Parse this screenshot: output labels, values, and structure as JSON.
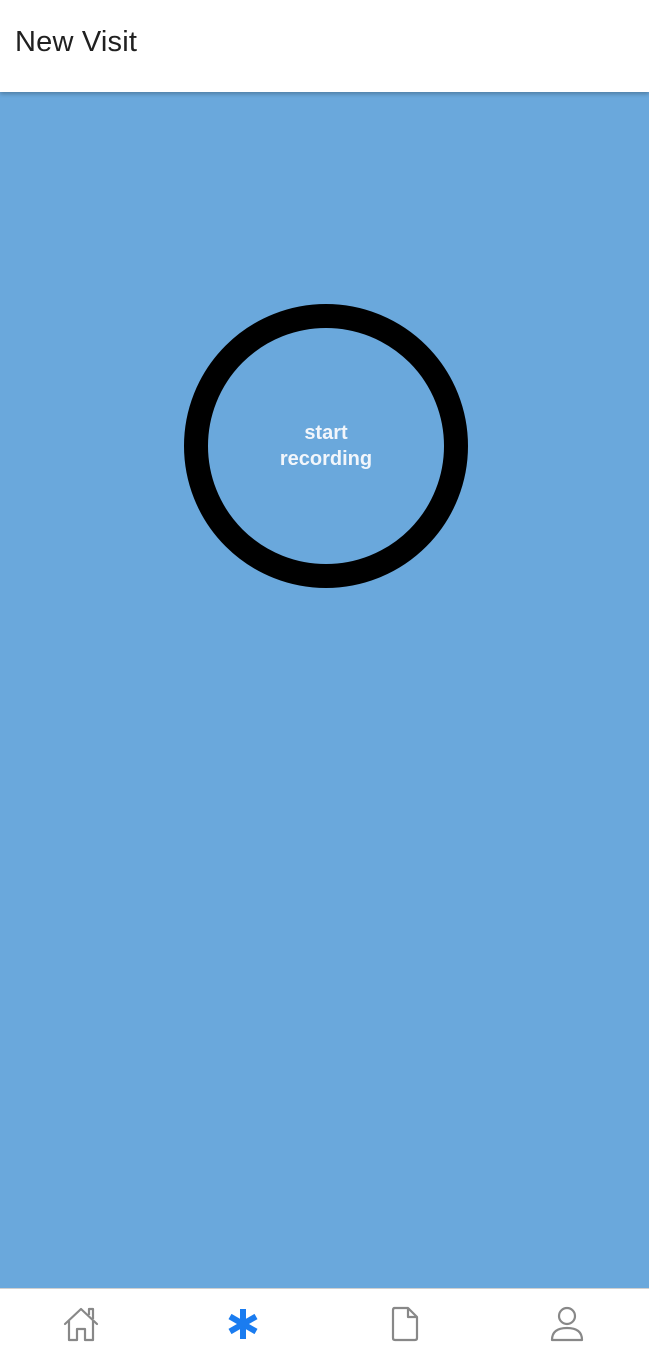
{
  "header": {
    "title": "New Visit"
  },
  "main": {
    "record_button": {
      "label": "start recording"
    },
    "background_color": "#6aa8dc"
  },
  "tabbar": {
    "active_color": "#1a7cf0",
    "inactive_color": "#888888",
    "tabs": [
      {
        "icon": "home-icon",
        "active": false
      },
      {
        "icon": "asterisk-icon",
        "active": true
      },
      {
        "icon": "document-icon",
        "active": false
      },
      {
        "icon": "person-icon",
        "active": false
      }
    ]
  }
}
